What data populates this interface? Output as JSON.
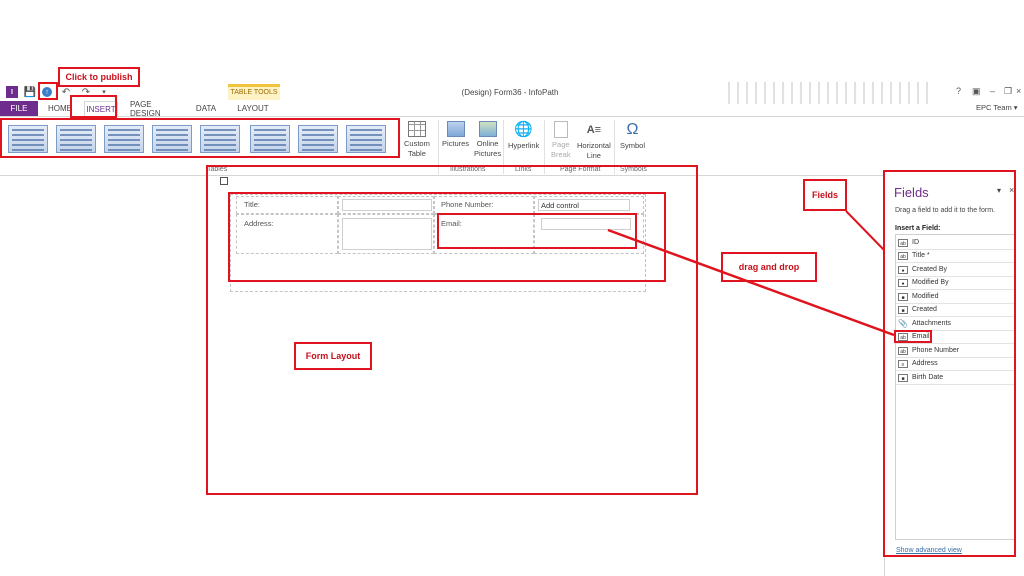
{
  "window": {
    "title": "(Design) Form36 - InfoPath",
    "account": "EPC Team",
    "help": "?"
  },
  "contextual_tab": {
    "label": "TABLE TOOLS"
  },
  "tabs": [
    {
      "label": "FILE"
    },
    {
      "label": "HOME"
    },
    {
      "label": "INSERT"
    },
    {
      "label": "PAGE DESIGN"
    },
    {
      "label": "DATA"
    },
    {
      "label": "LAYOUT"
    }
  ],
  "ribbon": {
    "custom_table": "Custom\nTable",
    "pictures": "Pictures",
    "online_pictures": "Online\nPictures",
    "hyperlink": "Hyperlink",
    "page_break": "Page\nBreak",
    "horizontal_line": "Horizontal\nLine",
    "symbol": "Symbol",
    "groups": {
      "tables": "Tables",
      "illustrations": "Illustrations",
      "links": "Links",
      "page_format": "Page Format",
      "symbols": "Symbols"
    }
  },
  "form": {
    "title_label": "Title:",
    "phone_label": "Phone Number:",
    "add_control": "Add control",
    "address_label": "Address:",
    "email_label": "Email:"
  },
  "fields_pane": {
    "title": "Fields",
    "instructions": "Drag a field to add it to the form.",
    "insert_label": "Insert a Field:",
    "fields": [
      {
        "label": "ID",
        "icon": "text-field-icon"
      },
      {
        "label": "Title *",
        "icon": "text-field-icon"
      },
      {
        "label": "Created By",
        "icon": "person-field-icon"
      },
      {
        "label": "Modified By",
        "icon": "person-field-icon"
      },
      {
        "label": "Modified",
        "icon": "date-field-icon"
      },
      {
        "label": "Created",
        "icon": "date-field-icon"
      },
      {
        "label": "Attachments",
        "icon": "paperclip-icon"
      },
      {
        "label": "Email",
        "icon": "text-field-icon"
      },
      {
        "label": "Phone Number",
        "icon": "text-field-icon"
      },
      {
        "label": "Address",
        "icon": "multiline-field-icon"
      },
      {
        "label": "Birth Date",
        "icon": "date-field-icon"
      }
    ],
    "show_advanced": "Show advanced view"
  },
  "annotations": {
    "publish": "Click to publish",
    "fields": "Fields",
    "drag_drop": "drag and drop",
    "form_layout": "Form Layout"
  },
  "colors": {
    "annotation_red": "#e0141e",
    "file_tab": "#6e2c8c",
    "accent_purple": "#6e2c8c"
  }
}
